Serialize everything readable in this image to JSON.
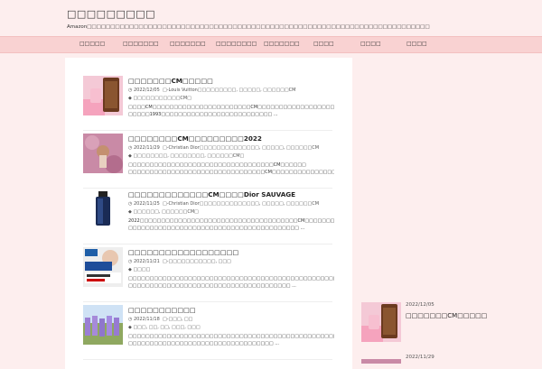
{
  "site": {
    "title": "□□□□□□□□□",
    "description": "Amazon□□□□□□□□□□□□□□□□□□□□□□□□□□□□□□□□□□□□□□□□□□□□□□□□□□□□□□□□□□□□□□□□□□□□□□□□□"
  },
  "nav": {
    "items": [
      "□□□□□",
      "□□□□□□□",
      "□□□□□□□",
      "□□□□□□□□",
      "□□□□□□□",
      "□□□□",
      "□□□□",
      "□□□□"
    ]
  },
  "posts": [
    {
      "title": "□□□□□□□CM□□□□□",
      "date": "2022/12/05",
      "categories": "□-Louis Vuitton□□□□□□□□□, □□□□□, □□□□□□CM",
      "tags": "□□□□□□□□□□□CM□",
      "excerpt": "□□□□CM□□□□□□□□□□□□□□□□□□□□□□□CM□□□□□□□□□□□□□□□□□□□□□□□□□□□□□□□□□□□□□□□□ □□□□□1993□□□□□□□□□□□□□□□□□□□□□□□□□□ ..."
    },
    {
      "title": "□□□□□□□□CM□□□□□□□□□2022",
      "date": "2022/11/29",
      "categories": "□-Christian Dior□□□□□□□□□□□□□□, □□□□□, □□□□□□CM",
      "tags": "□□□□□□□□, □□□□□□□□, □□□□□□CM□",
      "excerpt": "□□□□□□□□□□□□□□□□□□□□□□□□□□□□□□□□□□CM□□□□□□ □□□□□□□□□□□□□□□□□□□□□□□□□□□□□□□□CM□□□□□□□□□□□□□□□□□□□□□□□□□□□□□□□□ ..."
    },
    {
      "title": "□□□□□□□□□□□□□CM□□□□Dior SAUVAGE",
      "date": "2022/11/25",
      "categories": "□-Christian Dior□□□□□□□□□□□□□□, □□□□□, □□□□□□CM",
      "tags": "□□□□□□, □□□□□□CM□",
      "excerpt": "2022□□□□□□□□□□□□□□□□□□□□□□□□□□□□□□□□□□□□□CM□□□□□□□□□□□□□ □□□□□□□□□□□□□□□□□□□□□□□□□□□□□□□□□□□□□□□□ ..."
    },
    {
      "title": "□□□□□□□□□□□□□□□□□□",
      "date": "2022/11/21",
      "categories": "□-□□□□□□□□□□□, □□□",
      "tags": "□□□□",
      "excerpt": "□□□□□□□□□□□□□□□□□□□□□□□□□□□□□□□□□□□□□□□□□□□□□□□□□□□□□ □□□□□□□□□□□□□□□□□□□□□□□□□□□□□□□□□□□□□□ ..."
    },
    {
      "title": "□□□□□□□□□□□",
      "date": "2022/11/18",
      "categories": "□-□□□, □□",
      "tags": "□□□, □□, □□, □□□, □□□",
      "excerpt": "□□□□□□□□□□□□□□□□□□□□□□□□□□□□□□□□□□□□□□□□□□□□□□□□□□□□□□□□□□ □□□□□□□□□□□□□□□□□□□□□□□□□□□□□□□□□□ ..."
    }
  ],
  "sidebar": {
    "recent": [
      {
        "date": "2022/12/05",
        "title": "□□□□□□□CM□□□□□"
      },
      {
        "date": "2022/11/29",
        "title": ""
      }
    ]
  },
  "icons": {
    "date": "clock-icon",
    "category": "folder-icon",
    "tag": "tag-icon"
  },
  "colors": {
    "background": "#fdeeee",
    "nav": "#f9d2d2",
    "content": "#ffffff"
  }
}
